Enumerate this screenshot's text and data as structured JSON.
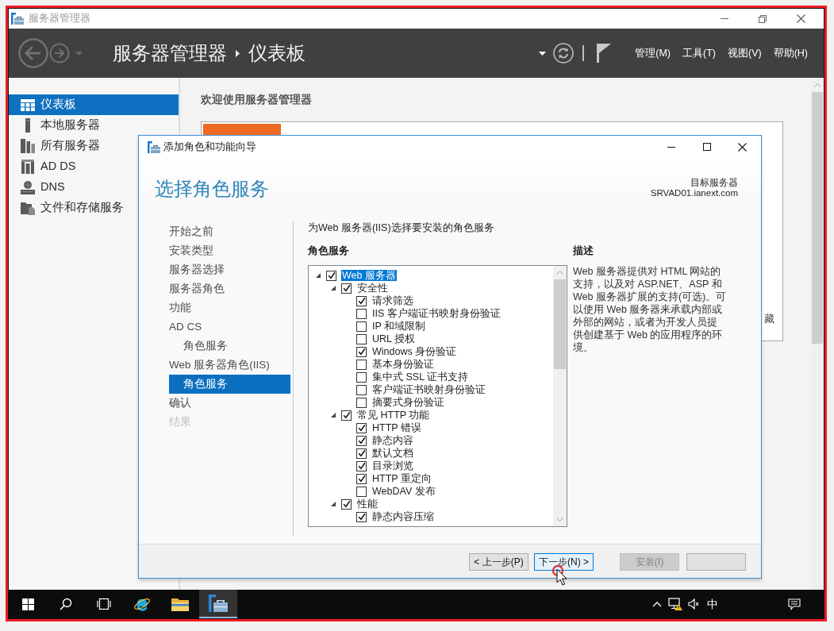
{
  "window": {
    "title": "服务器管理器"
  },
  "header": {
    "breadcrumb": [
      "服务器管理器",
      "仪表板"
    ],
    "menus": [
      "管理(M)",
      "工具(T)",
      "视图(V)",
      "帮助(H)"
    ]
  },
  "sidebar": {
    "items": [
      {
        "kind": "dashboard",
        "label": "仪表板",
        "selected": true
      },
      {
        "kind": "local-server",
        "label": "本地服务器",
        "selected": false
      },
      {
        "kind": "all-servers",
        "label": "所有服务器",
        "selected": false
      },
      {
        "kind": "ad-ds",
        "label": "AD DS",
        "selected": false
      },
      {
        "kind": "dns",
        "label": "DNS",
        "selected": false
      },
      {
        "kind": "file-storage",
        "label": "文件和存储服务",
        "selected": false
      }
    ]
  },
  "main": {
    "welcome_title": "欢迎使用服务器管理器",
    "card_text_fragment": "藏"
  },
  "dialog": {
    "title": "添加角色和功能向导",
    "heading": "选择角色服务",
    "target_label": "目标服务器",
    "target_server": "SRVAD01.ianext.com",
    "steps": [
      {
        "label": "开始之前",
        "selected": false,
        "disabled": false
      },
      {
        "label": "安装类型",
        "selected": false,
        "disabled": false
      },
      {
        "label": "服务器选择",
        "selected": false,
        "disabled": false
      },
      {
        "label": "服务器角色",
        "selected": false,
        "disabled": false
      },
      {
        "label": "功能",
        "selected": false,
        "disabled": false
      },
      {
        "label": "AD CS",
        "selected": false,
        "disabled": false,
        "children": [
          {
            "label": "角色服务",
            "selected": false,
            "disabled": false
          }
        ]
      },
      {
        "label": "Web 服务器角色(IIS)",
        "selected": false,
        "disabled": false,
        "children": [
          {
            "label": "角色服务",
            "selected": true,
            "disabled": false
          }
        ]
      },
      {
        "label": "确认",
        "selected": false,
        "disabled": false
      },
      {
        "label": "结果",
        "selected": false,
        "disabled": true
      }
    ],
    "instruction": "为Web 服务器(IIS)选择要安装的角色服务",
    "list_title": "角色服务",
    "tree": [
      {
        "label": "Web 服务器",
        "checked": true,
        "selected": true,
        "expanded": true,
        "children": [
          {
            "label": "安全性",
            "checked": true,
            "selected": false,
            "expanded": true,
            "children": [
              {
                "label": "请求筛选",
                "checked": true,
                "selected": false
              },
              {
                "label": "IIS 客户端证书映射身份验证",
                "checked": false,
                "selected": false
              },
              {
                "label": "IP 和域限制",
                "checked": false,
                "selected": false
              },
              {
                "label": "URL 授权",
                "checked": false,
                "selected": false
              },
              {
                "label": "Windows 身份验证",
                "checked": true,
                "selected": false
              },
              {
                "label": "基本身份验证",
                "checked": false,
                "selected": false
              },
              {
                "label": "集中式 SSL 证书支持",
                "checked": false,
                "selected": false
              },
              {
                "label": "客户端证书映射身份验证",
                "checked": false,
                "selected": false
              },
              {
                "label": "摘要式身份验证",
                "checked": false,
                "selected": false
              }
            ]
          },
          {
            "label": "常见 HTTP 功能",
            "checked": true,
            "selected": false,
            "expanded": true,
            "children": [
              {
                "label": "HTTP 错误",
                "checked": true,
                "selected": false
              },
              {
                "label": "静态内容",
                "checked": true,
                "selected": false
              },
              {
                "label": "默认文档",
                "checked": true,
                "selected": false
              },
              {
                "label": "目录浏览",
                "checked": true,
                "selected": false
              },
              {
                "label": "HTTP 重定向",
                "checked": true,
                "selected": false
              },
              {
                "label": "WebDAV 发布",
                "checked": false,
                "selected": false
              }
            ]
          },
          {
            "label": "性能",
            "checked": true,
            "selected": false,
            "expanded": true,
            "children": [
              {
                "label": "静态内容压缩",
                "checked": true,
                "selected": false
              }
            ]
          }
        ]
      }
    ],
    "description_title": "描述",
    "description": "Web 服务器提供对 HTML 网站的支持，以及对 ASP.NET、ASP 和 Web 服务器扩展的支持(可选)。可以使用 Web 服务器来承载内部或外部的网站，或者为开发人员提供创建基于 Web 的应用程序的环境。",
    "buttons": [
      {
        "label": "< 上一步(P)",
        "kind": "normal",
        "disabled": false
      },
      {
        "label": "下一步(N) >",
        "kind": "default",
        "disabled": false
      },
      {
        "label": "安装(I)",
        "kind": "normal",
        "disabled": true
      },
      {
        "kind": "normal",
        "disabled": false
      }
    ]
  },
  "taskbar": {
    "apps": [
      {
        "kind": "start",
        "selected": false
      },
      {
        "kind": "search",
        "selected": false
      },
      {
        "kind": "task-view",
        "selected": false
      },
      {
        "kind": "browser",
        "selected": false
      },
      {
        "kind": "file-explorer",
        "selected": false
      },
      {
        "kind": "server-manager",
        "selected": true
      }
    ],
    "tray": [
      {
        "kind": "show-hidden"
      },
      {
        "kind": "network"
      },
      {
        "kind": "volume"
      }
    ],
    "ime": "中"
  }
}
